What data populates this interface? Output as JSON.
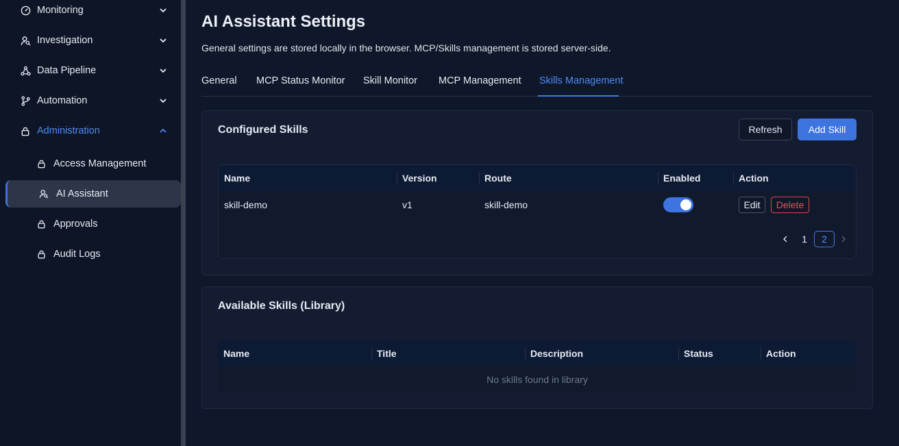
{
  "sidebar": {
    "groups": [
      {
        "label": "Monitoring",
        "icon": "gauge-icon"
      },
      {
        "label": "Investigation",
        "icon": "user-search-icon"
      },
      {
        "label": "Data Pipeline",
        "icon": "pipeline-icon"
      },
      {
        "label": "Automation",
        "icon": "branch-icon"
      },
      {
        "label": "Administration",
        "icon": "lock-icon"
      }
    ],
    "sub_items": [
      {
        "label": "Access Management",
        "icon": "lock-icon"
      },
      {
        "label": "AI Assistant",
        "icon": "user-search-icon"
      },
      {
        "label": "Approvals",
        "icon": "lock-icon"
      },
      {
        "label": "Audit Logs",
        "icon": "lock-icon"
      }
    ]
  },
  "page": {
    "title": "AI Assistant Settings",
    "subtitle": "General settings are stored locally in the browser. MCP/Skills management is stored server-side."
  },
  "tabs": [
    {
      "label": "General"
    },
    {
      "label": "MCP Status Monitor"
    },
    {
      "label": "Skill Monitor"
    },
    {
      "label": "MCP Management"
    },
    {
      "label": "Skills Management"
    }
  ],
  "configured": {
    "title": "Configured Skills",
    "refresh_label": "Refresh",
    "add_label": "Add Skill",
    "columns": [
      "Name",
      "Version",
      "Route",
      "Enabled",
      "Action"
    ],
    "rows": [
      {
        "name": "skill-demo",
        "version": "v1",
        "route": "skill-demo",
        "enabled": true,
        "edit_label": "Edit",
        "delete_label": "Delete"
      }
    ],
    "pagination": {
      "pages": [
        "1",
        "2"
      ],
      "current": "2"
    }
  },
  "library": {
    "title": "Available Skills (Library)",
    "columns": [
      "Name",
      "Title",
      "Description",
      "Status",
      "Action"
    ],
    "empty_text": "No skills found in library"
  },
  "colors": {
    "accent": "#3d74e0",
    "danger": "#e05555",
    "background": "#0f172a"
  }
}
